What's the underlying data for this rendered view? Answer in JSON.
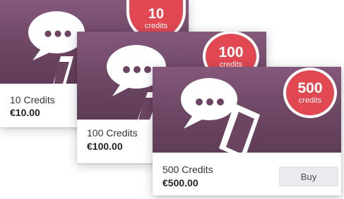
{
  "products": [
    {
      "badge_number": "10",
      "badge_label": "credits",
      "title": "10 Credits",
      "price": "€10.00",
      "icon": "chat-bubble-phone-icon"
    },
    {
      "badge_number": "100",
      "badge_label": "credits",
      "title": "100 Credits",
      "price": "€100.00",
      "icon": "chat-bubble-phone-icon"
    },
    {
      "badge_number": "500",
      "badge_label": "credits",
      "title": "500 Credits",
      "price": "€500.00",
      "icon": "chat-bubble-phone-icon",
      "buy_label": "Buy"
    }
  ],
  "colors": {
    "banner_top": "#84587b",
    "banner_bottom": "#5f3c57",
    "badge": "#e14852",
    "button_bg": "#e9ebef"
  }
}
